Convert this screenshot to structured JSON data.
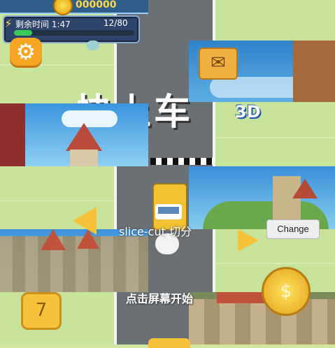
{
  "hud": {
    "coins": "000000",
    "time_label": "剩余时间 1:47",
    "count": "12/80",
    "progress": 0.15
  },
  "title": {
    "main": "快上车",
    "suffix": "3D"
  },
  "overlay": {
    "caption": "slice-cut 切分",
    "change_label": "Change",
    "start_hint": "点击屏幕开始"
  },
  "icons": {
    "settings": "gear-icon",
    "mail": "mail-icon",
    "task": "task-icon",
    "coin": "coin-icon"
  },
  "colors": {
    "accent_yellow": "#f7c23a",
    "grass": "#c8e39a",
    "road": "#6b7074"
  }
}
